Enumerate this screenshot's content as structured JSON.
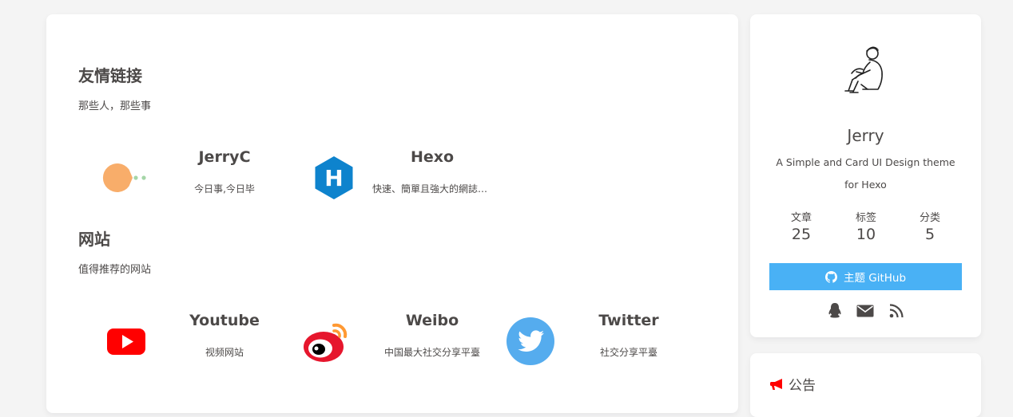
{
  "links_section": {
    "title": "友情链接",
    "desc": "那些人，那些事",
    "items": [
      {
        "name": "JerryC",
        "desc": "今日事,今日毕",
        "icon": "pacman-icon"
      },
      {
        "name": "Hexo",
        "desc": "快速、簡單且強大的網誌框架",
        "icon": "hexo-icon",
        "letter": "H"
      }
    ]
  },
  "sites_section": {
    "title": "网站",
    "desc": "值得推荐的网站",
    "items": [
      {
        "name": "Youtube",
        "desc": "视频网站",
        "icon": "youtube-icon"
      },
      {
        "name": "Weibo",
        "desc": "中国最大社交分享平臺",
        "icon": "weibo-icon"
      },
      {
        "name": "Twitter",
        "desc": "社交分享平臺",
        "icon": "twitter-icon"
      }
    ]
  },
  "author": {
    "name": "Jerry",
    "desc": "A Simple and Card UI Design theme for Hexo",
    "stats": [
      {
        "label": "文章",
        "value": "25"
      },
      {
        "label": "标签",
        "value": "10"
      },
      {
        "label": "分类",
        "value": "5"
      }
    ],
    "github_label": "主题 GitHub",
    "social_icons": [
      "qq-icon",
      "mail-icon",
      "rss-icon"
    ]
  },
  "announcement": {
    "title": "公告"
  },
  "colors": {
    "accent": "#49b1f5",
    "text": "#4c4948",
    "announce_icon": "#ff0000"
  }
}
